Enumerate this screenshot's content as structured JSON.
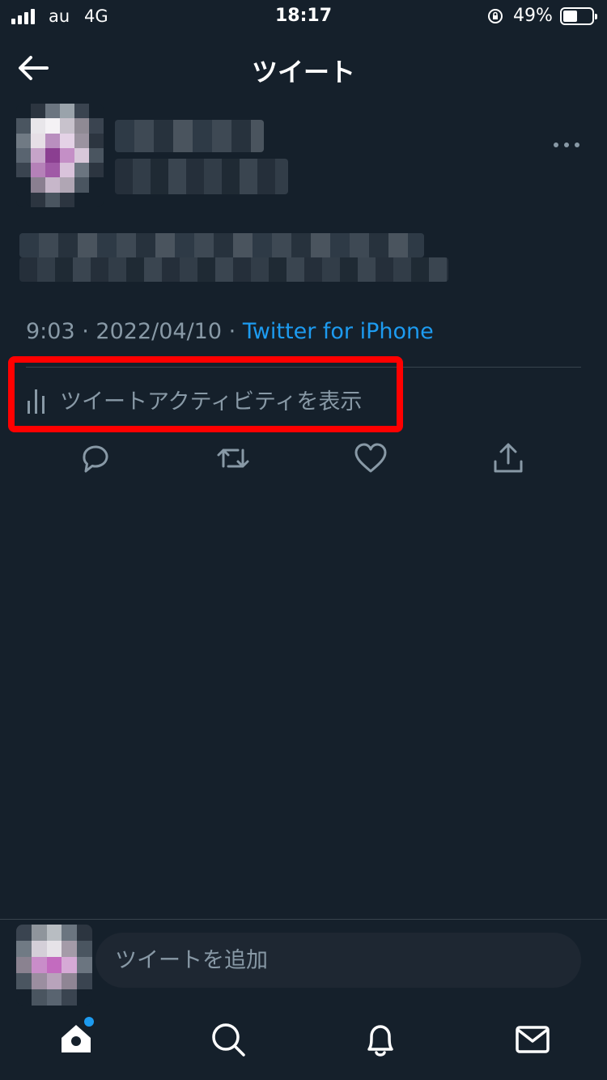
{
  "status_bar": {
    "carrier": "au",
    "network": "4G",
    "time": "18:17",
    "battery": "49%",
    "battery_level": 0.49
  },
  "header": {
    "title": "ツイート",
    "back_icon": "arrow-left-icon"
  },
  "tweet": {
    "more_icon": "more-horizontal-icon",
    "time": "9:03",
    "date": "2022/04/10",
    "separator": "·",
    "source": "Twitter for iPhone",
    "activity_label": "ツイートアクティビティを表示",
    "activity_icon": "bar-chart-icon",
    "actions": [
      {
        "name": "reply",
        "icon": "reply-icon"
      },
      {
        "name": "retweet",
        "icon": "retweet-icon"
      },
      {
        "name": "like",
        "icon": "heart-icon"
      },
      {
        "name": "share",
        "icon": "share-icon"
      }
    ]
  },
  "reply": {
    "placeholder": "ツイートを追加"
  },
  "tabbar": {
    "items": [
      {
        "name": "home",
        "icon": "home-icon"
      },
      {
        "name": "search",
        "icon": "search-icon"
      },
      {
        "name": "notifications",
        "icon": "bell-icon"
      },
      {
        "name": "messages",
        "icon": "mail-icon"
      }
    ]
  },
  "colors": {
    "background": "#15202b",
    "secondary_text": "#8899a6",
    "link": "#1d9bf0",
    "highlight": "#ff0000"
  }
}
